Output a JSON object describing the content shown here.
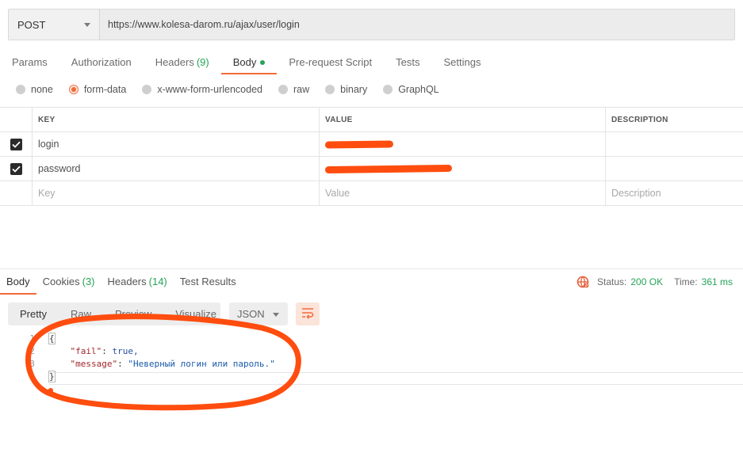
{
  "request": {
    "method": "POST",
    "url": "https://www.kolesa-darom.ru/ajax/user/login"
  },
  "request_tabs": [
    {
      "label": "Params",
      "count": ""
    },
    {
      "label": "Authorization",
      "count": ""
    },
    {
      "label": "Headers",
      "count": "(9)"
    },
    {
      "label": "Body",
      "count": ""
    },
    {
      "label": "Pre-request Script",
      "count": ""
    },
    {
      "label": "Tests",
      "count": ""
    },
    {
      "label": "Settings",
      "count": ""
    }
  ],
  "body_types": [
    "none",
    "form-data",
    "x-www-form-urlencoded",
    "raw",
    "binary",
    "GraphQL"
  ],
  "body_type_selected": "form-data",
  "params_table": {
    "headers": [
      "KEY",
      "VALUE",
      "DESCRIPTION"
    ],
    "rows": [
      {
        "checked": true,
        "key": "login"
      },
      {
        "checked": true,
        "key": "password"
      }
    ],
    "placeholders": {
      "key": "Key",
      "value": "Value",
      "description": "Description"
    }
  },
  "response": {
    "tabs": [
      {
        "label": "Body",
        "count": ""
      },
      {
        "label": "Cookies",
        "count": "(3)"
      },
      {
        "label": "Headers",
        "count": "(14)"
      },
      {
        "label": "Test Results",
        "count": ""
      }
    ],
    "status_label": "Status:",
    "status_value": "200 OK",
    "time_label": "Time:",
    "time_value": "361 ms",
    "view_modes": [
      "Pretty",
      "Raw",
      "Preview",
      "Visualize"
    ],
    "format": "JSON",
    "code_lines": [
      {
        "num": "1",
        "text": "{"
      },
      {
        "num": "2",
        "key": "\"fail\"",
        "value": "true,"
      },
      {
        "num": "3",
        "key": "\"message\"",
        "value": "\"Неверный логин или пароль.\""
      },
      {
        "num": "4",
        "text": "}"
      }
    ]
  },
  "colors": {
    "accent": "#f26b3a",
    "count_green": "#26a35a",
    "annotation": "#ff4d0f"
  },
  "icons": [
    "chevron-down-icon",
    "checkbox-checked-icon",
    "globe-icon",
    "wrap-lines-icon"
  ]
}
